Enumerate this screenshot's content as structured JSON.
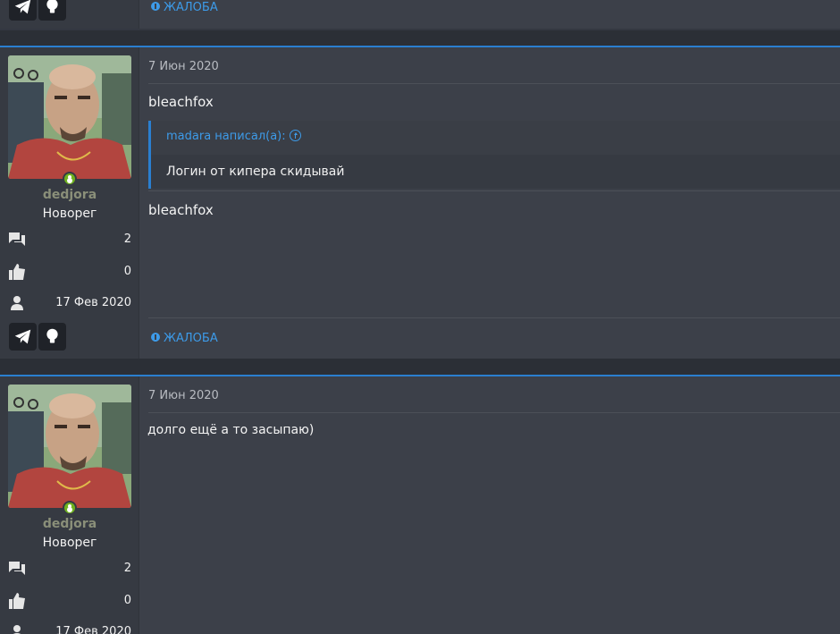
{
  "posts": [
    {
      "report_label": "ЖАЛОБА"
    },
    {
      "username": "dedjora",
      "role": "Новорег",
      "messages": "2",
      "reactions": "0",
      "joined": "17 Фев 2020",
      "date": "7 Июн 2020",
      "line1": "bleachfox",
      "quote_author": "madara написал(а):",
      "quote_text": "Логин от кипера скидывай",
      "line2": "bleachfox",
      "report_label": "ЖАЛОБА"
    },
    {
      "username": "dedjora",
      "role": "Новорег",
      "messages": "2",
      "reactions": "0",
      "joined": "17 Фев 2020",
      "date": "7 Июн 2020",
      "text": "долго ещё а то засыпаю)"
    }
  ],
  "icons": {
    "messages": "messages-icon",
    "reactions": "thumbs-up-icon",
    "joined": "user-icon",
    "telegram": "telegram-icon",
    "idea": "lightbulb-icon"
  },
  "colors": {
    "accent": "#2a7fd0",
    "link": "#3d9be9",
    "online": "#6fb31f"
  }
}
